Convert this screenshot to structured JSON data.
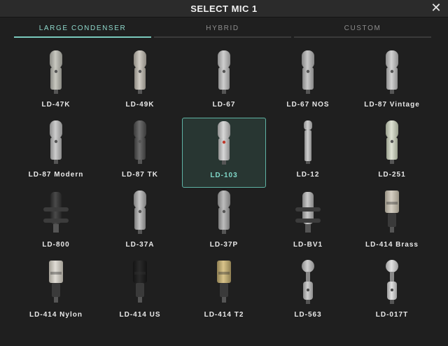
{
  "window": {
    "title": "SELECT MIC 1",
    "close_glyph": "✕"
  },
  "tabs": [
    {
      "label": "LARGE CONDENSER",
      "active": true
    },
    {
      "label": "HYBRID",
      "active": false
    },
    {
      "label": "CUSTOM",
      "active": false
    }
  ],
  "accent_color": "#79c9bc",
  "selected_mic": "LD-103",
  "mics": [
    {
      "label": "LD-47K",
      "icon": "tube-mic-icon"
    },
    {
      "label": "LD-49K",
      "icon": "tube-mic-icon"
    },
    {
      "label": "LD-67",
      "icon": "tube-mic-icon"
    },
    {
      "label": "LD-67 NOS",
      "icon": "tube-mic-icon"
    },
    {
      "label": "LD-87 Vintage",
      "icon": "tube-mic-icon"
    },
    {
      "label": "LD-87 Modern",
      "icon": "tube-mic-icon"
    },
    {
      "label": "LD-87 TK",
      "icon": "tube-mic-icon"
    },
    {
      "label": "LD-103",
      "icon": "tube-mic-icon"
    },
    {
      "label": "LD-12",
      "icon": "slim-mic-icon"
    },
    {
      "label": "LD-251",
      "icon": "tube-mic-icon"
    },
    {
      "label": "LD-800",
      "icon": "shockmount-mic-icon"
    },
    {
      "label": "LD-37A",
      "icon": "tube-mic-icon"
    },
    {
      "label": "LD-37P",
      "icon": "tube-mic-icon"
    },
    {
      "label": "LD-BV1",
      "icon": "shockmount-mic-icon"
    },
    {
      "label": "LD-414 Brass",
      "icon": "square-head-mic-icon"
    },
    {
      "label": "LD-414 Nylon",
      "icon": "square-head-mic-icon"
    },
    {
      "label": "LD-414 US",
      "icon": "square-head-mic-icon"
    },
    {
      "label": "LD-414 T2",
      "icon": "square-head-mic-icon"
    },
    {
      "label": "LD-563",
      "icon": "ball-head-mic-icon"
    },
    {
      "label": "LD-017T",
      "icon": "ball-head-mic-icon"
    }
  ]
}
